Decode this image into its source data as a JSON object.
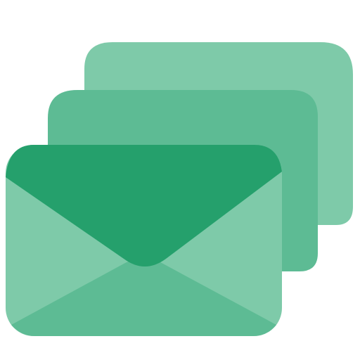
{
  "icon": {
    "name": "envelopes-stack-icon",
    "colors": {
      "back_card": "#7ecaa9",
      "middle_card": "#5dbb94",
      "front_base": "#7ecaa9",
      "front_bottom_flap": "#5dbb94",
      "front_top_flap": "#25a06c"
    }
  }
}
